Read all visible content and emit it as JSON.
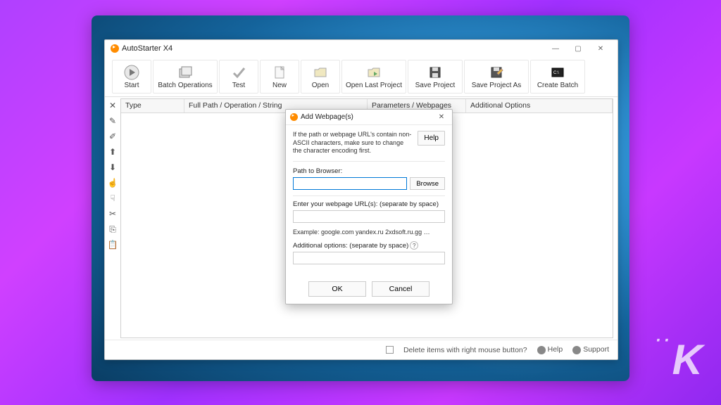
{
  "app": {
    "title": "AutoStarter X4"
  },
  "toolbar": [
    {
      "label": "Start",
      "icon": "play"
    },
    {
      "label": "Batch Operations",
      "icon": "batch"
    },
    {
      "label": "Test",
      "icon": "check"
    },
    {
      "label": "New",
      "icon": "new"
    },
    {
      "label": "Open",
      "icon": "open"
    },
    {
      "label": "Open Last Project",
      "icon": "open-last"
    },
    {
      "label": "Save Project",
      "icon": "save"
    },
    {
      "label": "Save Project As",
      "icon": "save-as"
    },
    {
      "label": "Create Batch",
      "icon": "batch-create"
    }
  ],
  "columns": {
    "type": "Type",
    "path": "Full Path / Operation / String",
    "params": "Parameters / Webpages",
    "additional": "Additional Options"
  },
  "statusbar": {
    "delete_hint": "Delete items with right mouse button?",
    "help": "Help",
    "support": "Support"
  },
  "dialog": {
    "title": "Add Webpage(s)",
    "hint": "If the path or webpage URL's contain non-ASCII characters, make sure to change the character encoding first.",
    "help_btn": "Help",
    "path_label": "Path to Browser:",
    "browse_btn": "Browse",
    "url_label": "Enter your webpage URL(s): (separate by space)",
    "example": "Example: google.com yandex.ru 2xdsoft.ru.gg …",
    "addopt_label": "Additional options: (separate by space)",
    "ok": "OK",
    "cancel": "Cancel"
  }
}
